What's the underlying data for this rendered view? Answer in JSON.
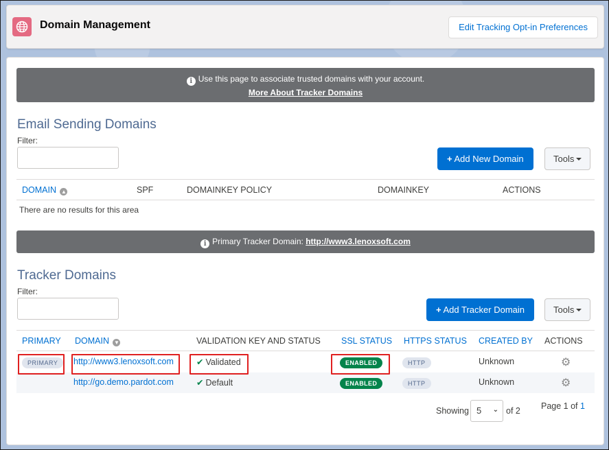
{
  "header": {
    "title": "Domain Management",
    "icon": "globe-icon",
    "button": "Edit Tracking Opt-in Preferences"
  },
  "banner1": {
    "text": "Use this page to associate trusted domains with your account.",
    "link": "More About Tracker Domains"
  },
  "email_section": {
    "title": "Email Sending Domains",
    "filter_label": "Filter:",
    "add_button": "Add New Domain",
    "tools_button": "Tools",
    "columns": [
      "DOMAIN",
      "SPF",
      "DOMAINKEY POLICY",
      "DOMAINKEY",
      "ACTIONS"
    ],
    "empty_text": "There are no results for this area"
  },
  "banner2": {
    "text": "Primary Tracker Domain:",
    "link": "http://www3.lenoxsoft.com"
  },
  "tracker_section": {
    "title": "Tracker Domains",
    "filter_label": "Filter:",
    "add_button": "Add Tracker Domain",
    "tools_button": "Tools",
    "columns": [
      "PRIMARY",
      "DOMAIN",
      "VALIDATION KEY AND STATUS",
      "SSL STATUS",
      "HTTPS STATUS",
      "CREATED BY",
      "ACTIONS"
    ],
    "rows": [
      {
        "primary": "PRIMARY",
        "domain": "http://www3.lenoxsoft.com",
        "validation": "Validated",
        "ssl": "ENABLED",
        "https": "HTTP",
        "created_by": "Unknown"
      },
      {
        "primary": "",
        "domain": "http://go.demo.pardot.com",
        "validation": "Default",
        "ssl": "ENABLED",
        "https": "HTTP",
        "created_by": "Unknown"
      }
    ]
  },
  "pager": {
    "showing": "Showing",
    "per_page": "5",
    "of_total": "of 2",
    "page_label": "Page 1 of",
    "page_total": "1"
  },
  "colors": {
    "brand": "#0070d2",
    "enabled": "#04844b",
    "banner": "#6b6d70",
    "highlight": "#e02020"
  }
}
